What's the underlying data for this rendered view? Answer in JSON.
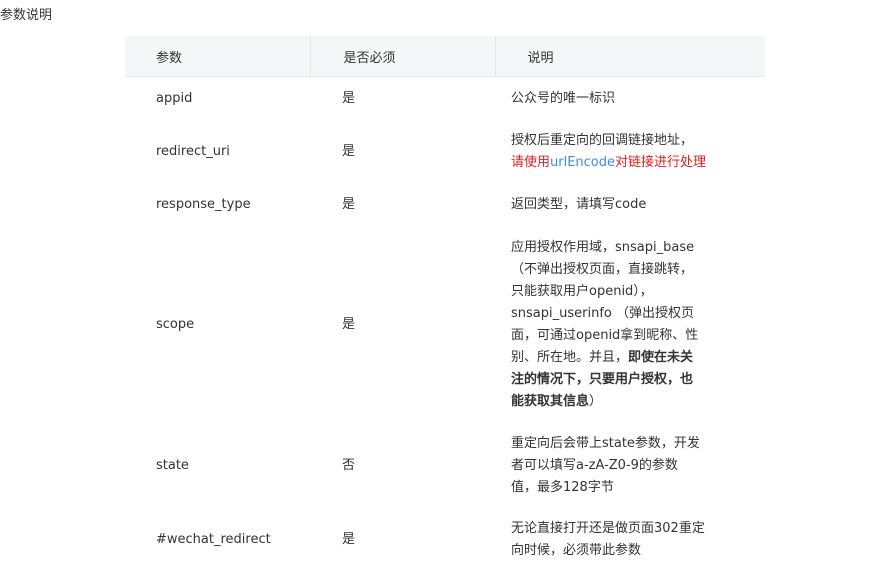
{
  "section_title": "参数说明",
  "table": {
    "headers": {
      "param": "参数",
      "required": "是否必须",
      "description": "说明"
    },
    "rows": [
      {
        "param": "appid",
        "required": "是",
        "desc": [
          "公众号的唯一标识"
        ]
      },
      {
        "param": "redirect_uri",
        "required": "是",
        "desc": [
          "授权后重定向的回调链接地址，"
        ],
        "desc_note_pre": "请使用",
        "desc_note_link": "urlEncode",
        "desc_note_post": "对链接进行处理"
      },
      {
        "param": "response_type",
        "required": "是",
        "desc": [
          "返回类型，请填写code"
        ]
      },
      {
        "param": "scope",
        "required": "是",
        "desc": [
          "应用授权作用域，snsapi_base",
          "（不弹出授权页面，直接跳转，",
          "只能获取用户openid），",
          "snsapi_userinfo （弹出授权页",
          "面，可通过openid拿到昵称、性",
          "别、所在地。并且，"
        ],
        "desc_bold_1": "即使在未关",
        "desc_bold_2": "注的情况下，只要用户授权，也",
        "desc_bold_3": "能获取其信息",
        "desc_tail": "）"
      },
      {
        "param": "state",
        "required": "否",
        "desc": [
          "重定向后会带上state参数，开发",
          "者可以填写a-zA-Z0-9的参数",
          "值，最多128字节"
        ]
      },
      {
        "param": "#wechat_redirect",
        "required": "是",
        "desc": [
          "无论直接打开还是做页面302重定",
          "向时候，必须带此参数"
        ]
      }
    ]
  }
}
